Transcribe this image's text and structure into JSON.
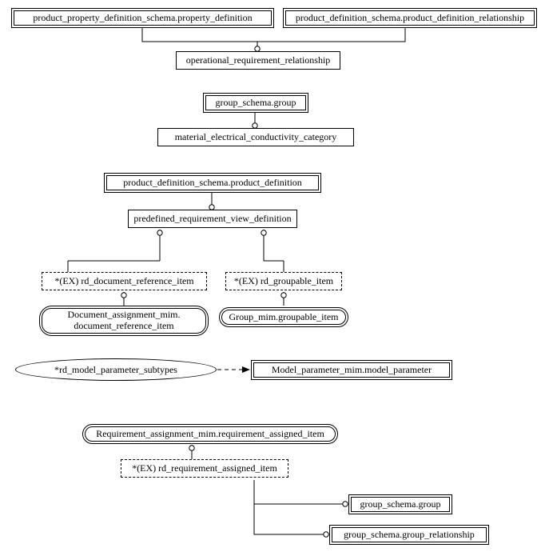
{
  "section1": {
    "left_parent": "product_property_definition_schema.property_definition",
    "right_parent": "product_definition_schema.product_definition_relationship",
    "child": "operational_requirement_relationship"
  },
  "section2": {
    "parent": "group_schema.group",
    "child": "material_electrical_conductivity_category"
  },
  "section3": {
    "root": "product_definition_schema.product_definition",
    "mid": "predefined_requirement_view_definition",
    "left_dashed": "*(EX) rd_document_reference_item",
    "right_dashed": "*(EX) rd_groupable_item",
    "left_leaf_line1": "Document_assignment_mim.",
    "left_leaf_line2": "document_reference_item",
    "right_leaf": "Group_mim.groupable_item"
  },
  "section4": {
    "ellipse": "*rd_model_parameter_subtypes",
    "target": "Model_parameter_mim.model_parameter"
  },
  "section5": {
    "root": "Requirement_assignment_mim.requirement_assigned_item",
    "dashed": "*(EX) rd_requirement_assigned_item",
    "leaf1": "group_schema.group",
    "leaf2": "group_schema.group_relationship"
  }
}
